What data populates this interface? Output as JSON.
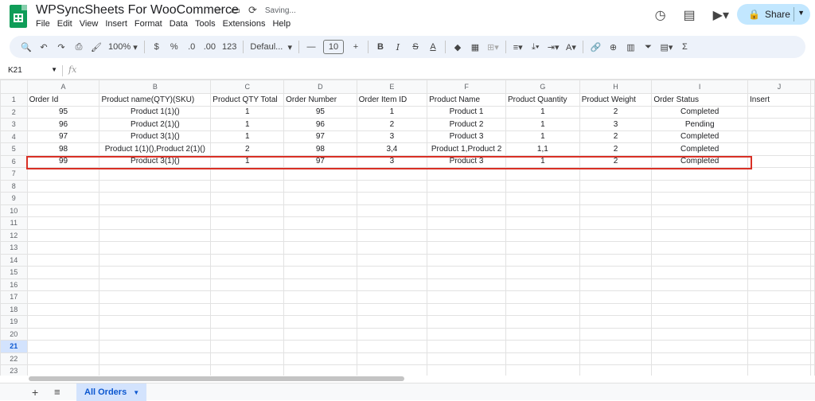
{
  "app": {
    "title": "WPSyncSheets For WooCommerce",
    "status": "Saving...",
    "menu": [
      "File",
      "Edit",
      "View",
      "Insert",
      "Format",
      "Data",
      "Tools",
      "Extensions",
      "Help"
    ],
    "share_label": "Share"
  },
  "toolbar": {
    "zoom": "100%",
    "currency": "$",
    "percent": "%",
    "dec_decrease": ".0",
    "dec_increase": ".00",
    "number_format": "123",
    "font": "Defaul...",
    "font_size": "10",
    "bold": "B",
    "italic": "I",
    "text_color": "A",
    "sum": "Σ"
  },
  "formula_bar": {
    "cell_ref": "K21",
    "fx": "fx"
  },
  "grid": {
    "columns": [
      "A",
      "B",
      "C",
      "D",
      "E",
      "F",
      "G",
      "H",
      "I",
      "J"
    ],
    "headers": [
      "Order Id",
      "Product name(QTY)(SKU)",
      "Product QTY Total",
      "Order Number",
      "Order Item ID",
      "Product Name",
      "Product Quantity",
      "Product Weight",
      "Order Status",
      "Insert"
    ],
    "rows": [
      [
        "95",
        "Product 1(1)()",
        "1",
        "95",
        "1",
        "Product 1",
        "1",
        "2",
        "Completed",
        ""
      ],
      [
        "96",
        "Product 2(1)()",
        "1",
        "96",
        "2",
        "Product 2",
        "1",
        "3",
        "Pending",
        ""
      ],
      [
        "97",
        "Product 3(1)()",
        "1",
        "97",
        "3",
        "Product 3",
        "1",
        "2",
        "Completed",
        ""
      ],
      [
        "98",
        "Product 1(1)(),Product 2(1)()",
        "2",
        "98",
        "3,4",
        "Product 1,Product 2",
        "1,1",
        "2",
        "Completed",
        ""
      ],
      [
        "99",
        "Product 3(1)()",
        "1",
        "97",
        "3",
        "Product 3",
        "1",
        "2",
        "Completed",
        ""
      ]
    ],
    "row_count": 23,
    "selected_row": 21
  },
  "tabs": {
    "active": "All Orders"
  }
}
